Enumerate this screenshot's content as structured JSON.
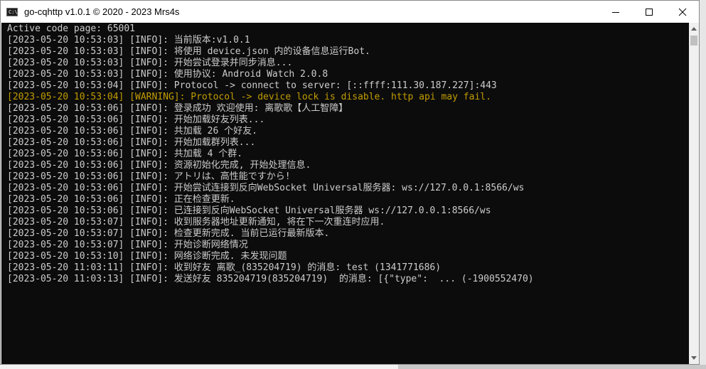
{
  "window": {
    "title": "go-cqhttp v1.0.1 © 2020 - 2023 Mrs4s",
    "icon_label": "C:\\",
    "controls": [
      "minimize-icon",
      "maximize-icon",
      "close-icon"
    ]
  },
  "colors": {
    "console_bg": "#0c0c0c",
    "text": "#cccccc",
    "warning": "#c19c00"
  },
  "console": {
    "lines": [
      {
        "text": "Active code page: 65001",
        "level": "plain"
      },
      {
        "text": "[2023-05-20 10:53:03] [INFO]: 当前版本:v1.0.1",
        "level": "info"
      },
      {
        "text": "[2023-05-20 10:53:03] [INFO]: 将使用 device.json 内的设备信息运行Bot.",
        "level": "info"
      },
      {
        "text": "[2023-05-20 10:53:03] [INFO]: 开始尝试登录并同步消息...",
        "level": "info"
      },
      {
        "text": "[2023-05-20 10:53:03] [INFO]: 使用协议: Android Watch 2.0.8",
        "level": "info"
      },
      {
        "text": "[2023-05-20 10:53:04] [INFO]: Protocol -> connect to server: [::ffff:111.30.187.227]:443",
        "level": "info"
      },
      {
        "text": "[2023-05-20 10:53:04] [WARNING]: Protocol -> device lock is disable. http api may fail.",
        "level": "warning"
      },
      {
        "text": "[2023-05-20 10:53:06] [INFO]: 登录成功 欢迎使用: 离歌歌【人工智障】",
        "level": "info"
      },
      {
        "text": "[2023-05-20 10:53:06] [INFO]: 开始加载好友列表...",
        "level": "info"
      },
      {
        "text": "[2023-05-20 10:53:06] [INFO]: 共加载 26 个好友.",
        "level": "info"
      },
      {
        "text": "[2023-05-20 10:53:06] [INFO]: 开始加载群列表...",
        "level": "info"
      },
      {
        "text": "[2023-05-20 10:53:06] [INFO]: 共加载 4 个群.",
        "level": "info"
      },
      {
        "text": "[2023-05-20 10:53:06] [INFO]: 资源初始化完成, 开始处理信息.",
        "level": "info"
      },
      {
        "text": "[2023-05-20 10:53:06] [INFO]: アトリは、高性能ですから!",
        "level": "info"
      },
      {
        "text": "[2023-05-20 10:53:06] [INFO]: 开始尝试连接到反向WebSocket Universal服务器: ws://127.0.0.1:8566/ws",
        "level": "info"
      },
      {
        "text": "[2023-05-20 10:53:06] [INFO]: 正在检查更新.",
        "level": "info"
      },
      {
        "text": "[2023-05-20 10:53:06] [INFO]: 已连接到反向WebSocket Universal服务器 ws://127.0.0.1:8566/ws",
        "level": "info"
      },
      {
        "text": "[2023-05-20 10:53:07] [INFO]: 收到服务器地址更新通知, 将在下一次重连时应用.",
        "level": "info"
      },
      {
        "text": "[2023-05-20 10:53:07] [INFO]: 检查更新完成. 当前已运行最新版本.",
        "level": "info"
      },
      {
        "text": "[2023-05-20 10:53:07] [INFO]: 开始诊断网络情况",
        "level": "info"
      },
      {
        "text": "[2023-05-20 10:53:10] [INFO]: 网络诊断完成. 未发现问题",
        "level": "info"
      },
      {
        "text": "[2023-05-20 11:03:11] [INFO]: 收到好友 离歌_(835204719) 的消息: test (1341771686)",
        "level": "info"
      },
      {
        "text": "[2023-05-20 11:03:13] [INFO]: 发送好友 835204719(835204719)  的消息: [{\"type\":  ... (-1900552470)",
        "level": "info"
      }
    ]
  }
}
